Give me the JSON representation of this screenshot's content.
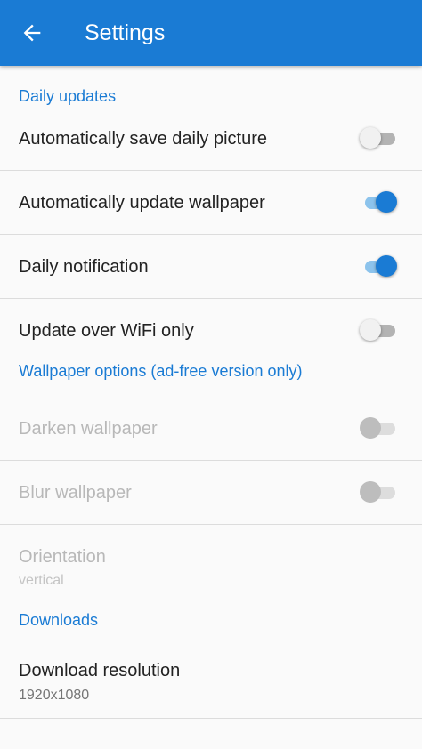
{
  "appbar": {
    "title": "Settings",
    "back_icon": "arrow-left-icon"
  },
  "colors": {
    "accent": "#1a7bd4",
    "track_on": "#8cc3ec",
    "divider": "#dcdcdc"
  },
  "sections": [
    {
      "header": "Daily updates",
      "rows": [
        {
          "label": "Automatically save daily picture",
          "toggle": false,
          "enabled": true
        },
        {
          "label": "Automatically update wallpaper",
          "toggle": true,
          "enabled": true
        },
        {
          "label": "Daily notification",
          "toggle": true,
          "enabled": true
        },
        {
          "label": "Update over WiFi only",
          "toggle": false,
          "enabled": true
        }
      ]
    },
    {
      "header": "Wallpaper options (ad-free version only)",
      "rows": [
        {
          "label": "Darken wallpaper",
          "toggle": false,
          "enabled": false
        },
        {
          "label": "Blur wallpaper",
          "toggle": false,
          "enabled": false
        },
        {
          "label": "Orientation",
          "summary": "vertical",
          "enabled": false
        }
      ]
    },
    {
      "header": "Downloads",
      "rows": [
        {
          "label": "Download resolution",
          "summary": "1920x1080",
          "enabled": true
        }
      ]
    }
  ]
}
